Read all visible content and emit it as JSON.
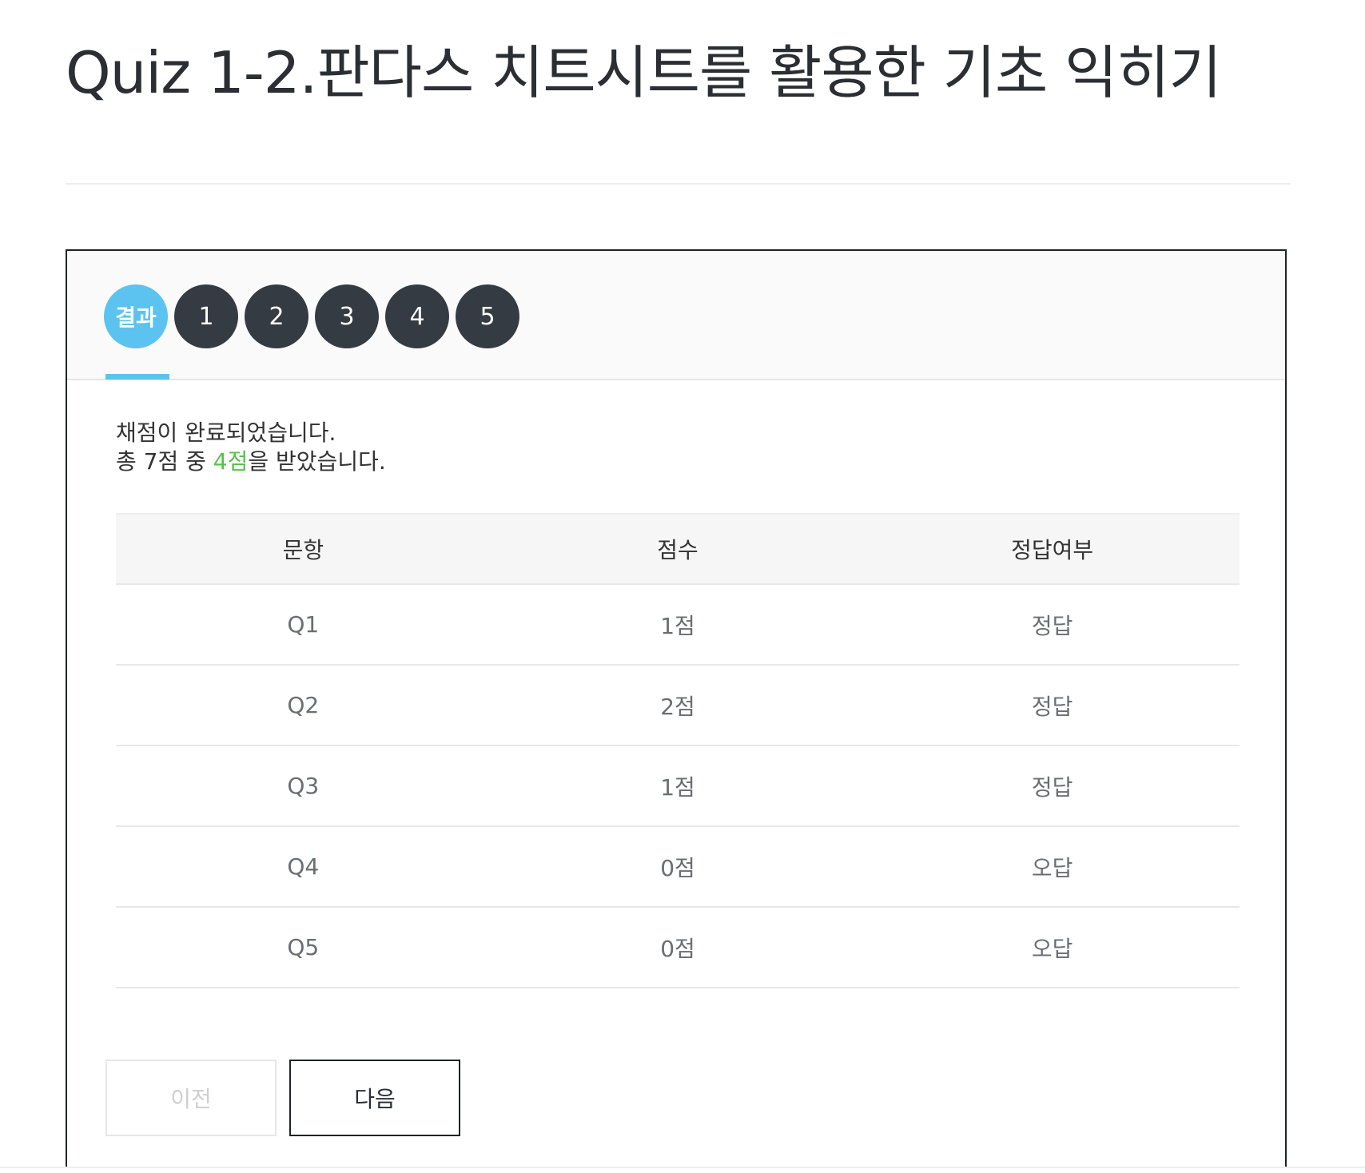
{
  "page": {
    "title": "Quiz 1-2.판다스 치트시트를 활용한 기초 익히기"
  },
  "tabs": [
    {
      "label": "결과",
      "active": true
    },
    {
      "label": "1",
      "active": false
    },
    {
      "label": "2",
      "active": false
    },
    {
      "label": "3",
      "active": false
    },
    {
      "label": "4",
      "active": false
    },
    {
      "label": "5",
      "active": false
    }
  ],
  "result": {
    "line1": "채점이 완료되었습니다.",
    "line2_prefix": "총 7점 중 ",
    "score": "4점",
    "line2_suffix": "을 받았습니다."
  },
  "table": {
    "headers": [
      "문항",
      "점수",
      "정답여부"
    ],
    "rows": [
      [
        "Q1",
        "1점",
        "정답"
      ],
      [
        "Q2",
        "2점",
        "정답"
      ],
      [
        "Q3",
        "1점",
        "정답"
      ],
      [
        "Q4",
        "0점",
        "오답"
      ],
      [
        "Q5",
        "0점",
        "오답"
      ]
    ]
  },
  "buttons": {
    "prev_label": "이전",
    "next_label": "다음",
    "prev_enabled": false
  },
  "colors": {
    "accent": "#5cc3f0",
    "tab_default": "#353b42",
    "score_highlight": "#56c14c",
    "border_dark": "#1f2326"
  }
}
